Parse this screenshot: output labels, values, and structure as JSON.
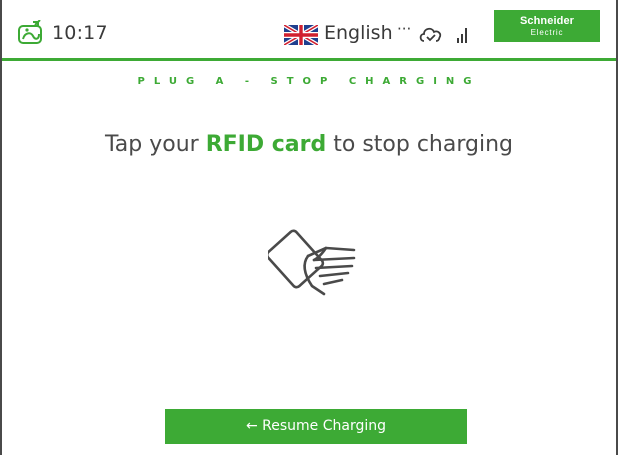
{
  "status_bar": {
    "time": "10:17",
    "language": "English",
    "more_glyph": "···",
    "icons": {
      "charger": "ev-charger-icon",
      "flag": "uk-flag-icon",
      "cloud": "cloud-connected-icon",
      "signal": "signal-strength-icon"
    }
  },
  "brand": {
    "name": "Schneider",
    "sub": "Electric",
    "color": "#3daa35"
  },
  "screen": {
    "title": "PLUG A - STOP CHARGING",
    "instruction_before": "Tap your ",
    "instruction_emphasis": "RFID card",
    "instruction_after": " to stop charging"
  },
  "illustration": {
    "icon": "rfid-card-tap-icon"
  },
  "actions": {
    "resume_label": "← Resume Charging"
  },
  "colors": {
    "accent": "#3daa35",
    "text": "#4a4a4a"
  }
}
